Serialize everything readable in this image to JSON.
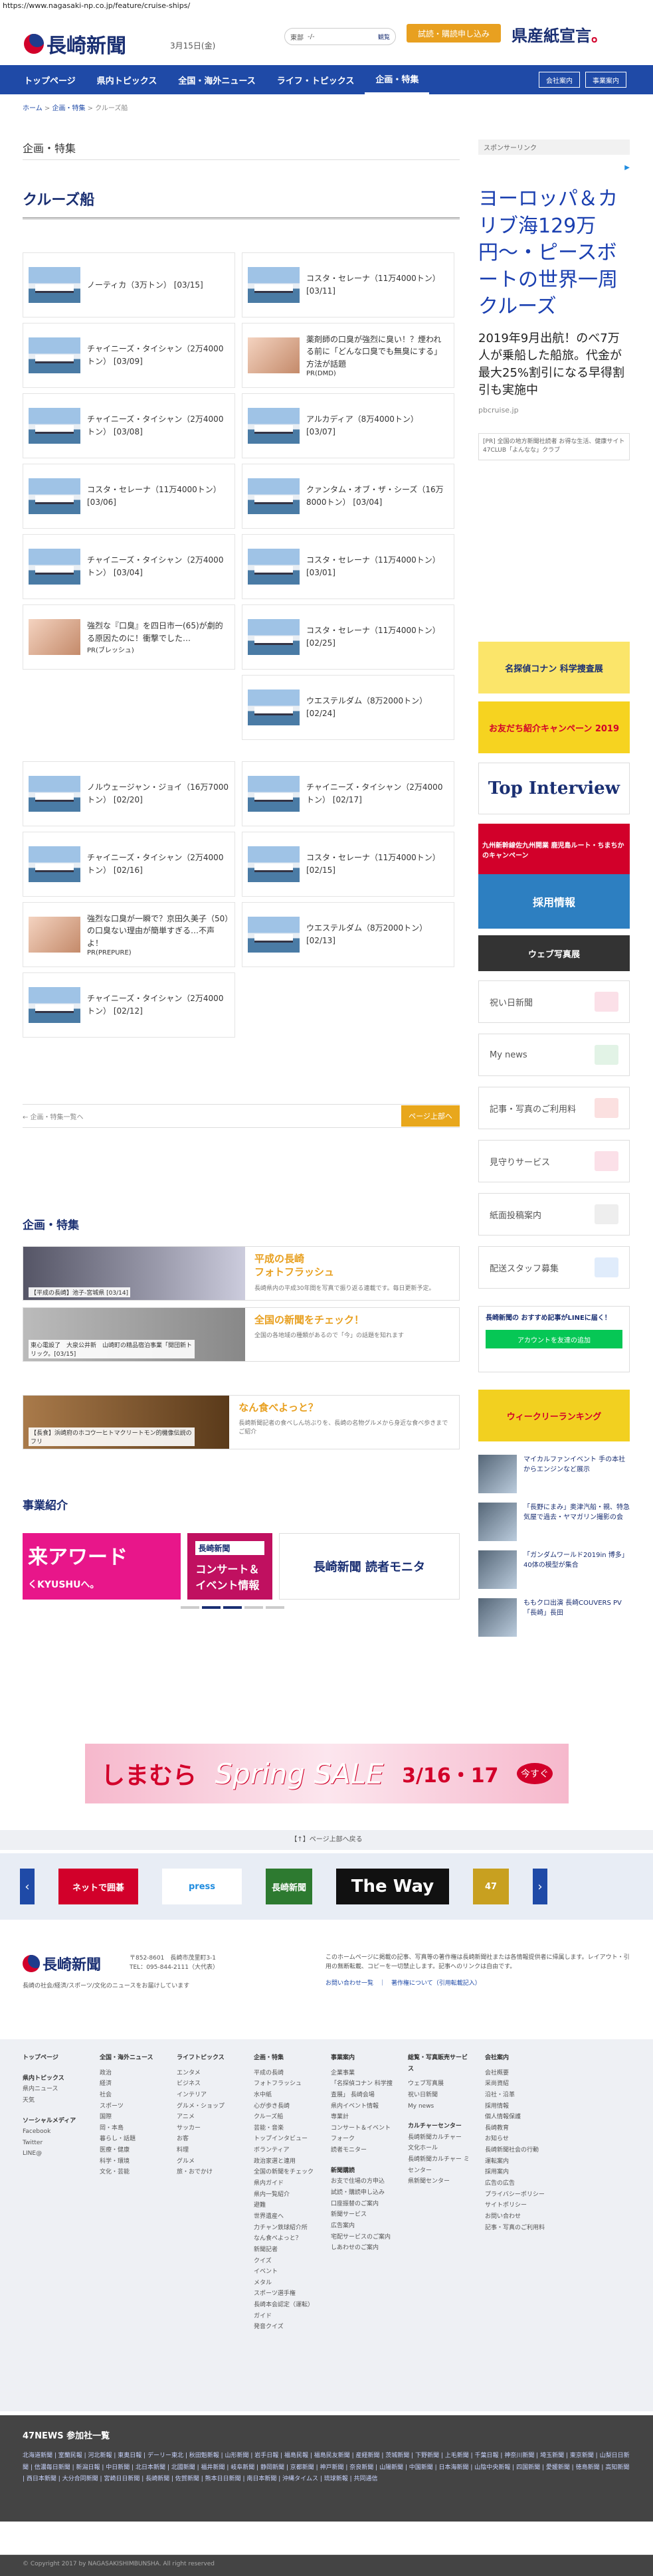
{
  "url": "https://www.nagasaki-np.co.jp/feature/cruise-ships/",
  "header": {
    "logo_text": "長崎新聞",
    "date": "3月15日(金)",
    "search_label": "東部",
    "search_value": "-/-",
    "search_button": "観覧",
    "trial_button": "試読・購読申し込み",
    "senden_text": "県産紙宣言",
    "senden_mark": "。"
  },
  "nav": {
    "items": [
      "トップページ",
      "県内トピックス",
      "全国・海外ニュース",
      "ライフ・トピックス",
      "企画・特集"
    ],
    "right": [
      "会社案内",
      "事業案内"
    ]
  },
  "breadcrumb": [
    "ホーム",
    "企画・特集",
    "クルーズ船"
  ],
  "main": {
    "category": "企画・特集",
    "title": "クルーズ船",
    "cards": [
      {
        "text": "ノーティカ（3万トン） [03/15]",
        "pr": ""
      },
      {
        "text": "コスタ・セレーナ（11万4000トン） [03/11]",
        "pr": ""
      },
      {
        "text": "チャイニーズ・タイシャン（2万4000トン） [03/09]",
        "pr": ""
      },
      {
        "text": "薬剤師の口臭が強烈に臭い！？煙われる前に「どんな口臭でも無臭にする」方法が話題",
        "pr": "PR(DMD)"
      },
      {
        "text": "チャイニーズ・タイシャン（2万4000トン） [03/08]",
        "pr": ""
      },
      {
        "text": "アルカディア（8万4000トン） [03/07]",
        "pr": ""
      },
      {
        "text": "コスタ・セレーナ（11万4000トン） [03/06]",
        "pr": ""
      },
      {
        "text": "クァンタム・オブ・ザ・シーズ（16万8000トン） [03/04]",
        "pr": ""
      },
      {
        "text": "チャイニーズ・タイシャン（2万4000トン） [03/04]",
        "pr": ""
      },
      {
        "text": "コスタ・セレーナ（11万4000トン） [03/01]",
        "pr": ""
      },
      {
        "text": "強烈な『口臭』を四日市一(65)が劇的る原因たのに！衝撃でした…",
        "pr": "PR(ブレッシュ)"
      },
      {
        "text": "コスタ・セレーナ（11万4000トン） [02/25]",
        "pr": ""
      },
      {
        "text": "ウエステルダム（8万2000トン） [02/24]",
        "pr": ""
      },
      {
        "text": "ノルウェージャン・ジョイ（16万7000トン） [02/20]",
        "pr": ""
      },
      {
        "text": "チャイニーズ・タイシャン（2万4000トン） [02/17]",
        "pr": ""
      },
      {
        "text": "チャイニーズ・タイシャン（2万4000トン） [02/16]",
        "pr": ""
      },
      {
        "text": "コスタ・セレーナ（11万4000トン） [02/15]",
        "pr": ""
      },
      {
        "text": "強烈な口臭が一瞬で？京田久美子（50）の口臭ない理由が簡単すぎる…不声よ！",
        "pr": "PR(PREPURE)"
      },
      {
        "text": "ウエステルダム（8万2000トン） [02/13]",
        "pr": ""
      },
      {
        "text": "チャイニーズ・タイシャン（2万4000トン） [02/12]",
        "pr": ""
      }
    ],
    "pager_back": "← 企画・特集一覧ヘ",
    "pager_next": "ページ上部へ"
  },
  "feature": {
    "title": "企画・特集",
    "items": [
      {
        "title": "平成の長崎\nフォトフラッシュ",
        "desc": "長崎県内の平成30年間を写真で振り返る連載です。毎日更新予定。",
        "cap": "【平成の長崎】池子-宮城県 [03/14]"
      },
      {
        "title": "全国の新聞をチェック！",
        "desc": "全国の各地域の種類があるので「今」の話題を知れます",
        "cap": "東心電設了　大泉公井新　山崎町の精品宿泊事業「開団新トリック。[03/15]"
      },
      {
        "title": "なん食べよっと？",
        "desc": "長崎新聞記者の食べしん坊ぶりを、長崎の名物グルメから身近な食べ歩きまでご紹介",
        "cap": "【長食】浜崎府のホコウ一ヒトマクリートモン的機像伝説のフリ"
      }
    ]
  },
  "business": {
    "title": "事業紹介",
    "slide_a": "来アワード",
    "slide_a_sub": "くKYUSHUへ。",
    "slide_b_title": "長崎新聞",
    "slide_b": "コンサート＆イベント情報",
    "slide_c": "長崎新聞 読者モニタ"
  },
  "side": {
    "sponsor": "スポンサーリンク",
    "ad_title": "ヨーロッパ＆カリブ海129万円〜・ピースボートの世界一周クルーズ",
    "ad_body": "2019年9月出航！のべ7万人が乗船した船旅。代金が最大25%割引になる早得割引も実施中",
    "ad_url": "pbcruise.jp",
    "pr_note": "[PR] 全国の地方新聞社読者 お得な生活、健康サイト 47CLUB「よんなな」クラブ",
    "banners": [
      "名探偵コナン 科学捜査展",
      "お友だち紹介キャンペーン 2019",
      "Top Interview",
      "九州新幹線佐九州開業 鹿児島ルート・ちまちかのキャンペーン",
      "採用情報",
      "ウェブ写真展"
    ],
    "boxes": [
      "祝い日新聞",
      "My news",
      "記事・写真のご利用料",
      "見守りサービス",
      "紙面投稿案内",
      "配送スタッフ募集"
    ],
    "line_title": "長崎新聞の おすすめ記事がLINEに届く！",
    "line_btn": "アカウントを友達の追加",
    "ranking": "ウィークリーランキング",
    "items": [
      "マイカルファンイベント 手の本社からエンジンなど展示",
      "「長野にまみ」奥津汽船・親、特急気屋で過去・ヤマガリン撮影の会",
      "「ガンダムワールド2019in 博多」 40体の模型が集合",
      "ももクロ出演 長崎COUVERS PV「長崎」長田"
    ]
  },
  "ad_banner": {
    "brand": "しまむら",
    "sale": "Spring SALE",
    "dates": "3/16・17",
    "tag": "今すぐ"
  },
  "pageup": "【↑】ページ上部へ戻る",
  "carousel": [
    "ネットで囲碁",
    "press",
    "長崎新聞",
    "The Way",
    "47"
  ],
  "footer": {
    "logo": "長崎新聞",
    "address": "〒852-8601　長崎市茂里町3-1",
    "tel": "TEL：095-844-2111（大代表）",
    "desc": "長崎の社会/経済/スポーツ/文化のニュースをお届けしています",
    "note": "このホームページに掲載の記事、写真等の著作権は長崎新聞社または各情報提供者に帰属します。レイアウト・引用の無断転載、コピーを一切禁止します。記事へのリンクは自由です。",
    "links": "お問い合わせ一覧　｜　著作権について（引用転載記入）",
    "sitemap": [
      {
        "head": "トップページ",
        "rows": [],
        "sub": [
          {
            "head": "県内トピックス",
            "rows": [
              "県内ニュース",
              "天気"
            ]
          },
          {
            "head": "ソーシャルメディア",
            "rows": [
              "Facebook",
              "Twitter",
              "LINE@"
            ]
          }
        ]
      },
      {
        "head": "全国・海外ニュース",
        "rows": [
          "政治",
          "経済",
          "社会",
          "スポーツ",
          "国際",
          "岡・本島",
          "暮らし・話題",
          "医療・健康",
          "科学・環境",
          "文化・芸能"
        ],
        "sub": []
      },
      {
        "head": "ライフトピックス",
        "rows": [
          "エンタメ",
          "ビジネス",
          "インテリア",
          "グルメ・ショップ",
          "アニメ",
          "サッカー",
          "お客",
          "料理",
          "グルメ",
          "旅・おでかけ"
        ],
        "sub": []
      },
      {
        "head": "企画・特集",
        "rows": [
          "平成の長崎",
          "フォトフラッシュ",
          "水中紙",
          "心が歩き長崎",
          "クルーズ船",
          "芸能・音楽",
          "トップインタビュー",
          "ボランティア",
          "政治家選と連用",
          "全国の新聞をチェック",
          "県内ガイド",
          "県内一覧紹介",
          "避難",
          "世界遺産へ",
          "力チャン鉄球紹介所",
          "なん食べよっと？",
          "新聞記者",
          "クイズ",
          "イベント",
          "メタル",
          "スポーツ選手権",
          "長崎本会認定（運転）ガイド",
          "発音クイズ"
        ],
        "sub": []
      },
      {
        "head": "事業案内",
        "rows": [
          "企業事業",
          "「名探偵コナン 科学捜査展」 長崎会場",
          "県内イベント情報",
          "専業計",
          "コンサート＆イベント",
          "フォーク",
          "読者モニター"
        ],
        "sub": [
          {
            "head": "新聞購読",
            "rows": [
              "お支で住場の方申込",
              "試読・購読申し込み",
              "口座振替のご案内",
              "新聞サービス",
              "広告案内",
              "宅配サービスのご案内",
              "しあわせのご案内"
            ]
          }
        ]
      },
      {
        "head": "総覧・写真販売サービス",
        "rows": [
          "ウェブ写真展",
          "祝い日新聞",
          "My news"
        ],
        "sub": [
          {
            "head": "カルチャーセンター",
            "rows": [
              "長崎新聞カルチャー",
              "文化ホール",
              "長崎新聞カルチャー ミセンター",
              "県新聞センター"
            ]
          }
        ]
      },
      {
        "head": "会社案内",
        "rows": [
          "会社概要",
          "采尚資紹",
          "沿社・沿革",
          "採用情報",
          "個人情報保護",
          "長崎教育",
          "お知らせ",
          "長崎新聞社会の行動",
          "運転案内",
          "採用案内",
          "広告の広告",
          "プライバシーポリシー",
          "サイトポリシー",
          "お問い合わせ",
          "記事・写真のご利用料"
        ],
        "sub": []
      }
    ],
    "news47_title": "47NEWS 参加社一覧",
    "news47_list": "北海道新聞 | 室蘭民報 | 河北新報 | 東奥日報 | デーリー東北 | 秋田魁新報 | 山形新聞 | 岩手日報 | 福島民報 | 福島民友新聞 | 産経新聞 | 茨城新聞 | 下野新聞 | 上毛新聞 | 千葉日報 | 神奈川新聞 | 埼玉新聞 | 東京新聞 | 山梨日日新聞 | 信濃毎日新聞 | 新潟日報 | 中日新聞 | 北日本新聞 | 北國新聞 | 福井新聞 | 岐阜新聞 | 静岡新聞 | 京都新聞 | 神戸新聞 | 奈良新聞 | 山陽新聞 | 中国新聞 | 日本海新聞 | 山陰中央新報 | 四国新聞 | 愛媛新聞 | 徳島新聞 | 高知新聞 | 西日本新聞 | 大分合同新聞 | 宮崎日日新聞 | 長崎新聞 | 佐賀新聞 | 熊本日日新聞 | 南日本新聞 | 沖縄タイムス | 琉球新報 | 共同通信",
    "copyright": "© Copyright 2017 by NAGASAKISHIMBUNSHA. All right reserved"
  }
}
